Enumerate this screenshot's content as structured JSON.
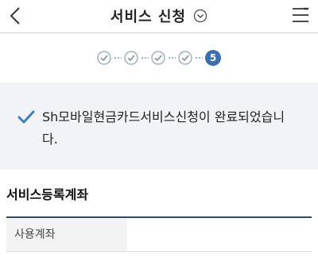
{
  "header": {
    "title": "서비스 신청"
  },
  "steps": {
    "current_step": "5"
  },
  "result": {
    "message": "Sh모바일현금카드서비스신청이 완료되었습니다."
  },
  "section": {
    "title": "서비스등록계좌"
  },
  "account_table": {
    "rows": [
      {
        "label": "사용계좌",
        "value": ""
      }
    ]
  },
  "colors": {
    "accent": "#3b6fb0",
    "check": "#3a7fc4",
    "panel_bg": "#f1f3f7",
    "table_border": "#2e4a6b"
  }
}
